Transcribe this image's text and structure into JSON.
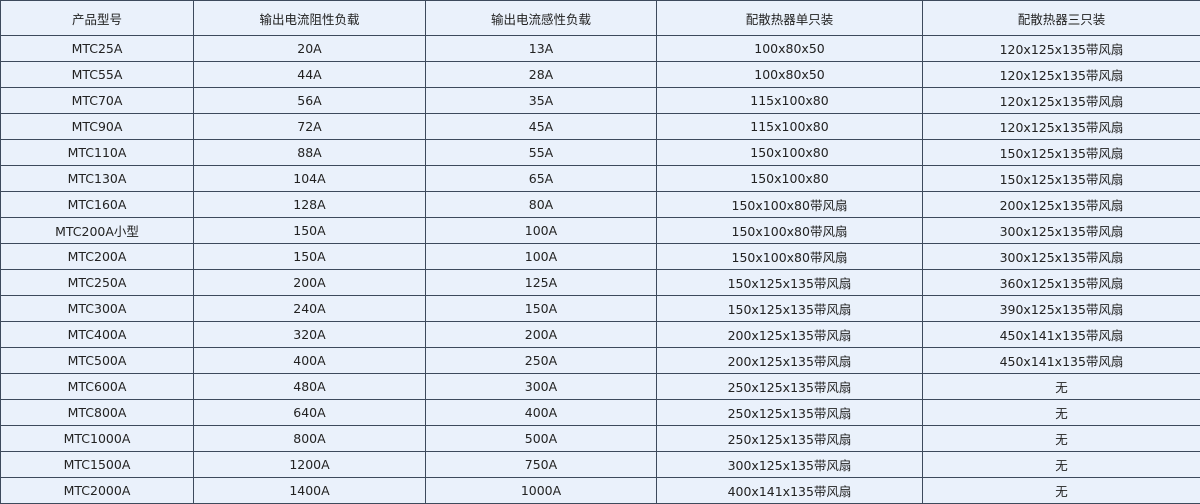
{
  "table": {
    "headers": [
      "产品型号",
      "输出电流阻性负载",
      "输出电流感性负载",
      "配散热器单只装",
      "配散热器三只装"
    ],
    "rows": [
      [
        "MTC25A",
        "20A",
        "13A",
        "100x80x50",
        "120x125x135带风扇"
      ],
      [
        "MTC55A",
        "44A",
        "28A",
        "100x80x50",
        "120x125x135带风扇"
      ],
      [
        "MTC70A",
        "56A",
        "35A",
        "115x100x80",
        "120x125x135带风扇"
      ],
      [
        "MTC90A",
        "72A",
        "45A",
        "115x100x80",
        "120x125x135带风扇"
      ],
      [
        "MTC110A",
        "88A",
        "55A",
        "150x100x80",
        "150x125x135带风扇"
      ],
      [
        "MTC130A",
        "104A",
        "65A",
        "150x100x80",
        "150x125x135带风扇"
      ],
      [
        "MTC160A",
        "128A",
        "80A",
        "150x100x80带风扇",
        "200x125x135带风扇"
      ],
      [
        "MTC200A小型",
        "150A",
        "100A",
        "150x100x80带风扇",
        "300x125x135带风扇"
      ],
      [
        "MTC200A",
        "150A",
        "100A",
        "150x100x80带风扇",
        "300x125x135带风扇"
      ],
      [
        "MTC250A",
        "200A",
        "125A",
        "150x125x135带风扇",
        "360x125x135带风扇"
      ],
      [
        "MTC300A",
        "240A",
        "150A",
        "150x125x135带风扇",
        "390x125x135带风扇"
      ],
      [
        "MTC400A",
        "320A",
        "200A",
        "200x125x135带风扇",
        "450x141x135带风扇"
      ],
      [
        "MTC500A",
        "400A",
        "250A",
        "200x125x135带风扇",
        "450x141x135带风扇"
      ],
      [
        "MTC600A",
        "480A",
        "300A",
        "250x125x135带风扇",
        "无"
      ],
      [
        "MTC800A",
        "640A",
        "400A",
        "250x125x135带风扇",
        "无"
      ],
      [
        "MTC1000A",
        "800A",
        "500A",
        "250x125x135带风扇",
        "无"
      ],
      [
        "MTC1500A",
        "1200A",
        "750A",
        "300x125x135带风扇",
        "无"
      ],
      [
        "MTC2000A",
        "1400A",
        "1000A",
        "400x141x135带风扇",
        "无"
      ]
    ]
  }
}
